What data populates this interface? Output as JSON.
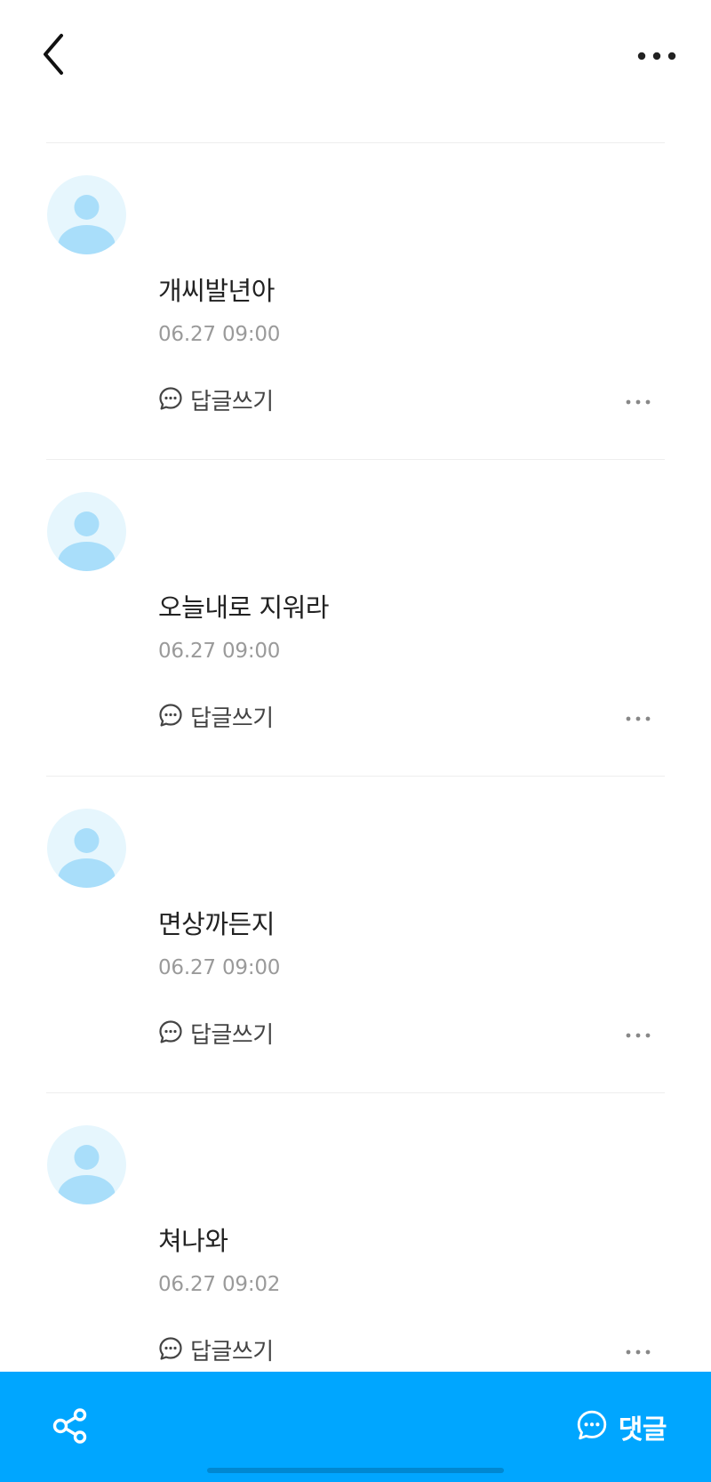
{
  "header": {
    "back_icon": "chevron-left-icon",
    "more_icon": "more-horizontal-icon"
  },
  "comments": [
    {
      "text": "개씨발년아",
      "time": "06.27 09:00",
      "reply_label": "답글쓰기"
    },
    {
      "text": "오늘내로 지워라",
      "time": "06.27 09:00",
      "reply_label": "답글쓰기"
    },
    {
      "text": "면상까든지",
      "time": "06.27 09:00",
      "reply_label": "답글쓰기"
    },
    {
      "text": "쳐나와",
      "time": "06.27 09:02",
      "reply_label": "답글쓰기"
    }
  ],
  "bottom_bar": {
    "share_icon": "share-icon",
    "comment_label": "댓글",
    "comment_icon": "chat-bubble-icon"
  },
  "colors": {
    "accent": "#00a6ff",
    "avatar_bg": "#e6f6fd",
    "avatar_figure": "#a9defa",
    "time_text": "#9a9a9a"
  }
}
